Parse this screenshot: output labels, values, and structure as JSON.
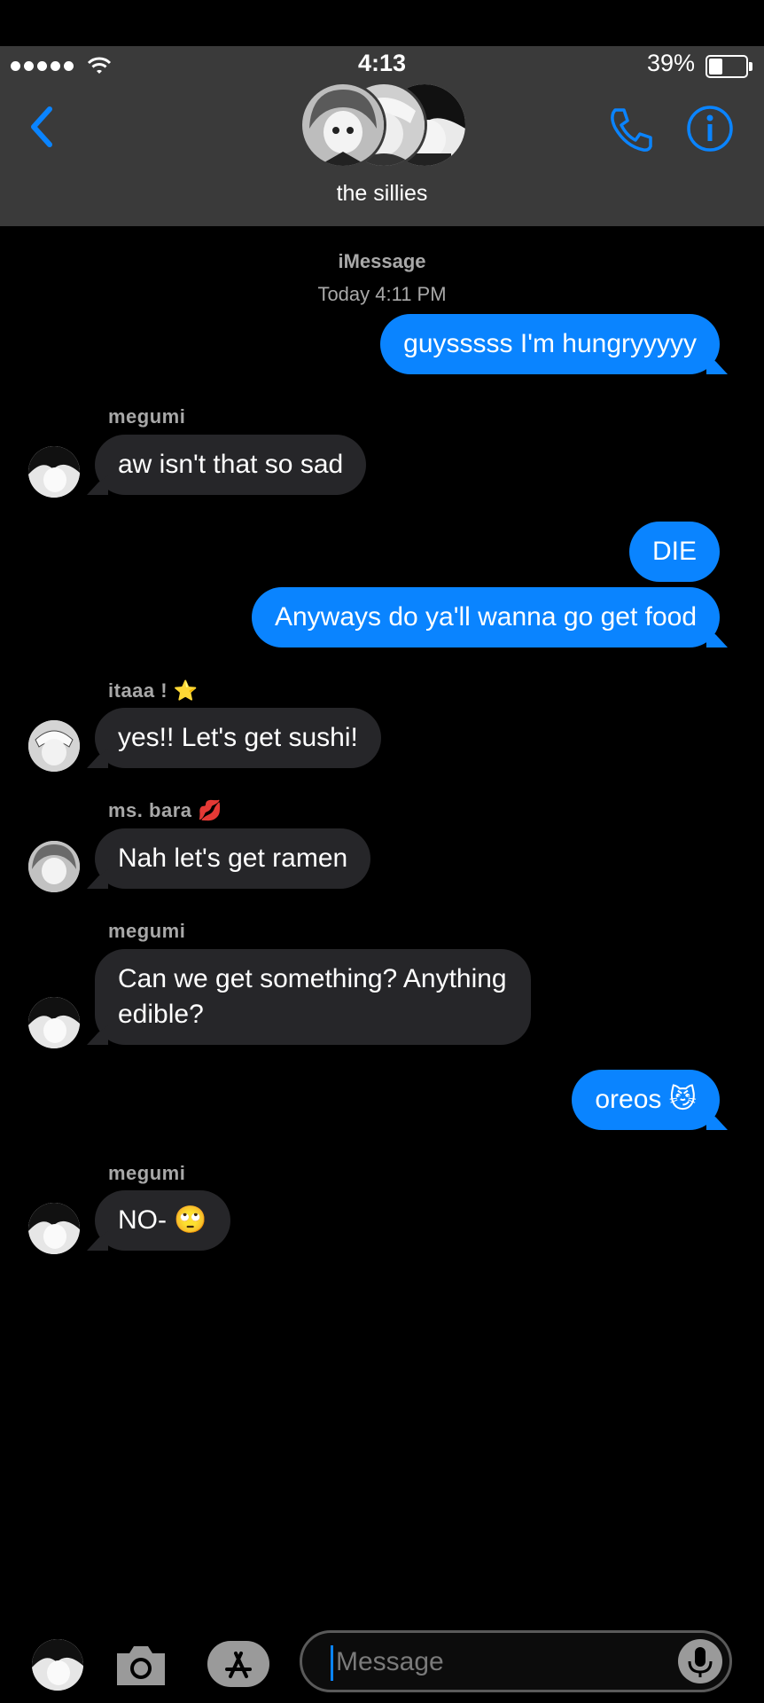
{
  "status_bar": {
    "time": "4:13",
    "battery": "39%"
  },
  "header": {
    "group_name": "the sillies"
  },
  "thread": {
    "service": "iMessage",
    "timestamp": "Today 4:11 PM",
    "messages": [
      {
        "from": "me",
        "text": "guysssss I'm hungryyyyy"
      },
      {
        "from": "megumi",
        "sender_label": "megumi",
        "text": "aw isn't that so sad"
      },
      {
        "from": "me",
        "text": "DIE"
      },
      {
        "from": "me",
        "text": "Anyways do ya'll wanna go get food"
      },
      {
        "from": "itaa",
        "sender_label": "itaaa !",
        "sender_emoji": "⭐",
        "text": "yes!! Let's get sushi!"
      },
      {
        "from": "bara",
        "sender_label": "ms. bara",
        "sender_emoji": "💋",
        "text": "Nah let's get ramen"
      },
      {
        "from": "megumi",
        "sender_label": "megumi",
        "text_line1": "Can we get something? Anything",
        "text_line2": "edible?"
      },
      {
        "from": "me",
        "text": "oreos",
        "emoji": "😼"
      },
      {
        "from": "megumi",
        "sender_label": "megumi",
        "text": "NO-",
        "emoji": "🙄"
      }
    ]
  },
  "composer": {
    "placeholder": "Message"
  },
  "colors": {
    "outgoing": "#0a84ff",
    "incoming": "#262629",
    "header": "#3a3a3a",
    "accent": "#0a84ff"
  },
  "icons": [
    "back-chevron-icon",
    "phone-icon",
    "info-icon",
    "camera-icon",
    "app-store-icon",
    "microphone-icon",
    "wifi-icon",
    "battery-icon"
  ]
}
